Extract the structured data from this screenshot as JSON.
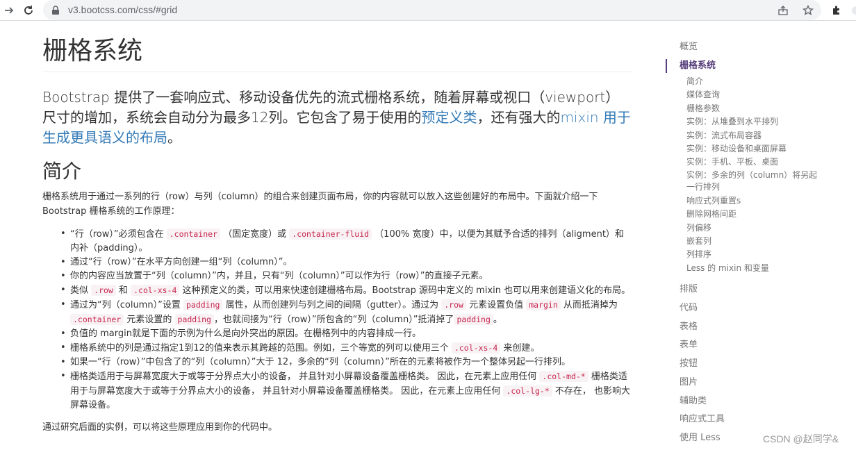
{
  "browser": {
    "url": "v3.bootcss.com/css/#grid"
  },
  "content": {
    "title": "栅格系统",
    "lead": {
      "text1": "Bootstrap 提供了一套响应式、移动设备优先的流式栅格系统，随着屏幕或视口（viewport）尺寸的增加，系统会自动分为最多12列。它包含了易于使用的",
      "link1": "预定义类",
      "text2": "，还有强大的",
      "link2": "mixin 用于生成更具语义的布局",
      "text3": "。"
    },
    "intro_heading": "简介",
    "intro_para": "栅格系统用于通过一系列的行（row）与列（column）的组合来创建页面布局，你的内容就可以放入这些创建好的布局中。下面就介绍一下 Bootstrap 栅格系统的工作原理：",
    "points": {
      "p1a": "“行（row）”必须包含在 ",
      "p1c1": ".container",
      "p1b": " （固定宽度）或 ",
      "p1c2": ".container-fluid",
      "p1c": " （100% 宽度）中，以便为其赋予合适的排列（aligment）和内补（padding）。",
      "p2": "通过“行（row）”在水平方向创建一组“列（column）”。",
      "p3": "你的内容应当放置于“列（column）”内，并且，只有“列（column）”可以作为行（row）”的直接子元素。",
      "p4a": "类似 ",
      "p4c1": ".row",
      "p4b": " 和 ",
      "p4c2": ".col-xs-4",
      "p4c": " 这种预定义的类，可以用来快速创建栅格布局。Bootstrap 源码中定义的 mixin 也可以用来创建语义化的布局。",
      "p5a": "通过为“列（column）”设置 ",
      "p5c1": "padding",
      "p5b": " 属性，从而创建列与列之间的间隔（gutter）。通过为 ",
      "p5c2": ".row",
      "p5c": " 元素设置负值 ",
      "p5c3": "margin",
      "p5d": " 从而抵消掉为 ",
      "p5c4": ".container",
      "p5e": " 元素设置的 ",
      "p5c5": "padding",
      "p5f": "，也就间接为“行（row）”所包含的“列（column）”抵消掉了",
      "p5c6": "padding",
      "p5g": "。",
      "p6": "负值的 margin就是下面的示例为什么是向外突出的原因。在栅格列中的内容排成一行。",
      "p7a": "栅格系统中的列是通过指定1到12的值来表示其跨越的范围。例如，三个等宽的列可以使用三个 ",
      "p7c1": ".col-xs-4",
      "p7b": " 来创建。",
      "p8": "如果一“行（row）”中包含了的“列（column）”大于 12，多余的“列（column）”所在的元素将被作为一个整体另起一行排列。",
      "p9a": "栅格类适用于与屏幕宽度大于或等于分界点大小的设备， 并且针对小屏幕设备覆盖栅格类。 因此，在元素上应用任何 ",
      "p9c1": ".col-md-*",
      "p9b": " 栅格类适用于与屏幕宽度大于或等于分界点大小的设备， 并且针对小屏幕设备覆盖栅格类。 因此，在元素上应用任何 ",
      "p9c2": ".col-lg-*",
      "p9c": " 不存在， 也影响大屏幕设备。"
    },
    "closing": "通过研究后面的实例，可以将这些原理应用到你的代码中。"
  },
  "sidenav": {
    "overview": "概览",
    "active": "栅格系统",
    "subs": [
      "简介",
      "媒体查询",
      "栅格参数",
      "实例：从堆叠到水平排列",
      "实例：流式布局容器",
      "实例：移动设备和桌面屏幕",
      "实例：手机、平板、桌面",
      "实例：多余的列（column）将另起",
      "一行排列",
      "响应式列重置s",
      "删除网格间距",
      "列偏移",
      "嵌套列",
      "列排序",
      "Less 的 mixin 和变量"
    ],
    "sections": [
      "排版",
      "代码",
      "表格",
      "表单",
      "按钮",
      "图片",
      "辅助类",
      "响应式工具",
      "使用 Less"
    ]
  },
  "watermark": "CSDN @赵同学&"
}
